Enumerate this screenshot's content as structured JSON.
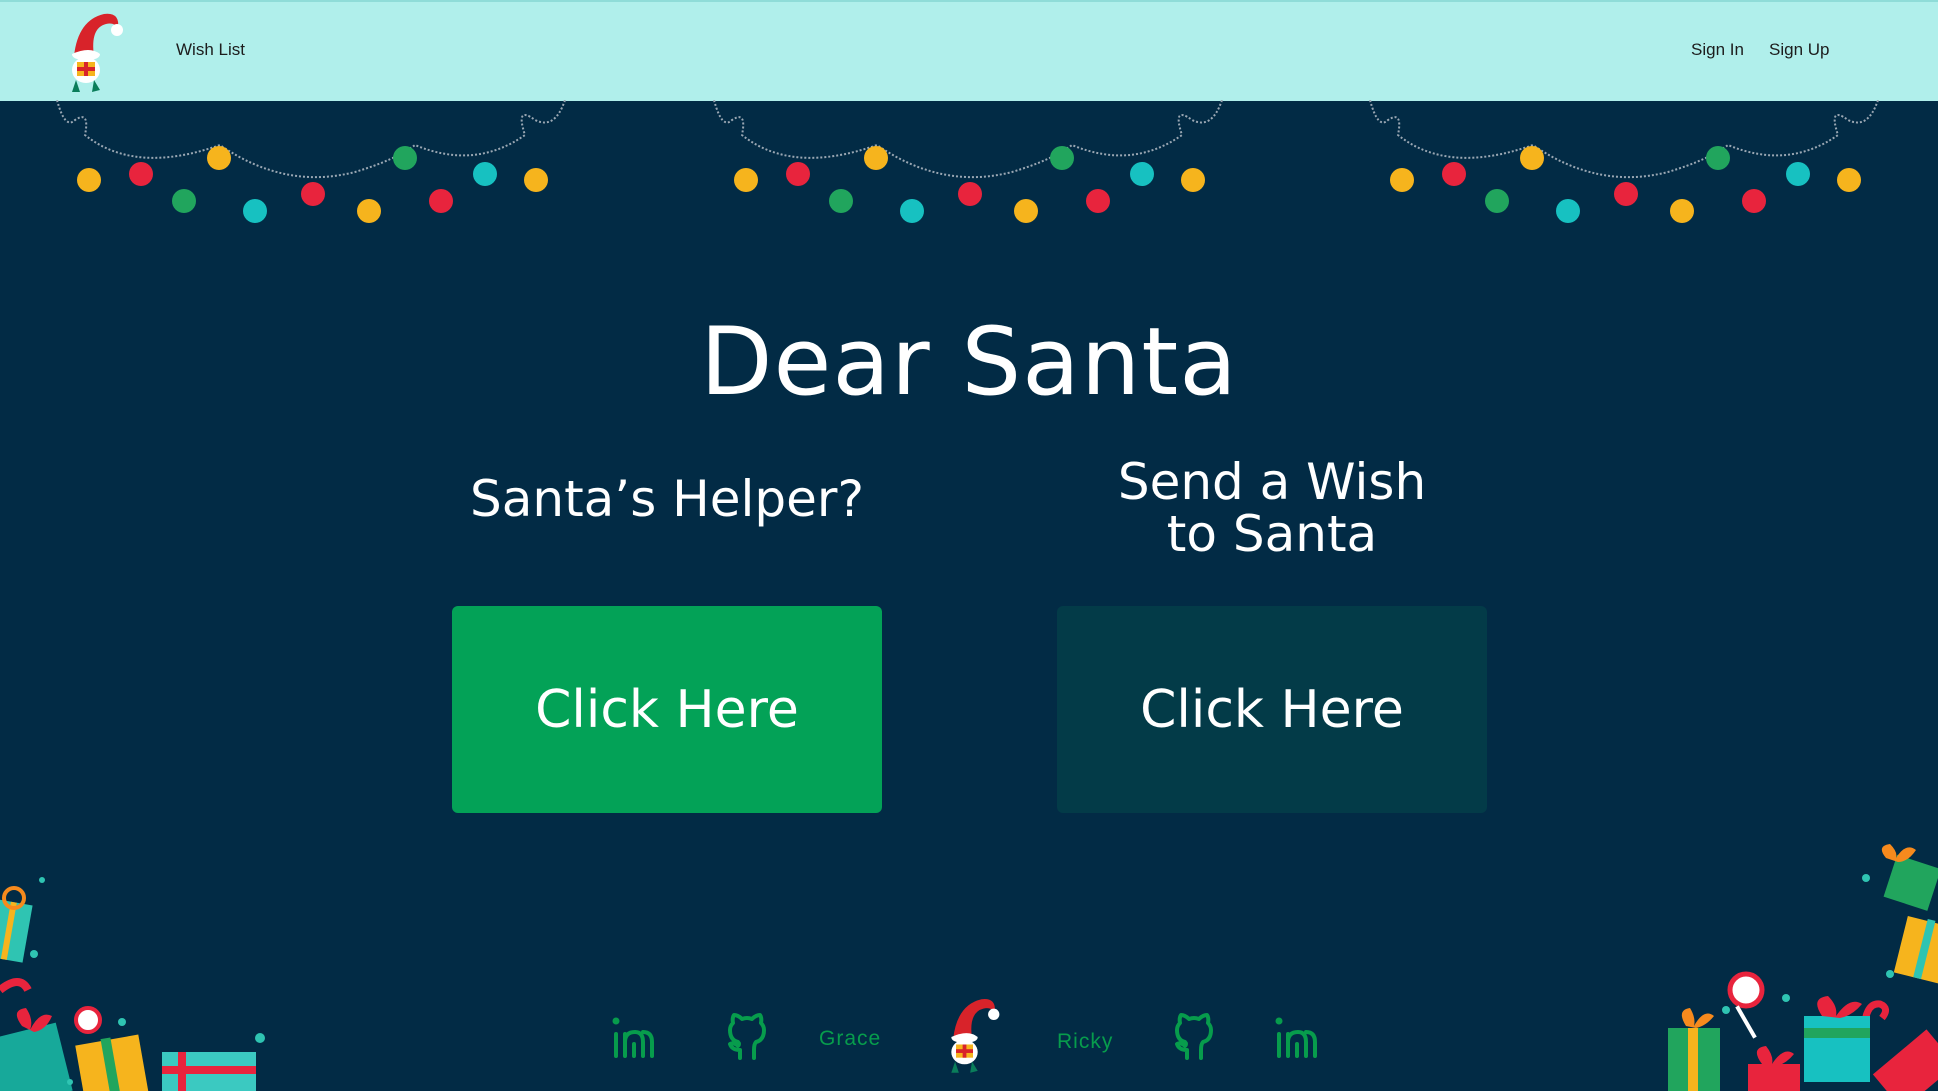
{
  "nav": {
    "logo_icon": "gnome-logo-icon",
    "wish_list_label": "Wish List",
    "sign_in_label": "Sign In",
    "sign_up_label": "Sign Up"
  },
  "hero": {
    "title": "Dear Santa"
  },
  "columns": {
    "helper": {
      "heading": "Santa’s Helper?",
      "button_label": "Click Here",
      "button_color": "#03a257"
    },
    "wish": {
      "heading": "Send a Wish\nto Santa",
      "button_label": "Click Here",
      "button_color": "#033b48"
    }
  },
  "footer": {
    "left_linkedin_icon": "linkedin-icon",
    "left_github_icon": "github-icon",
    "left_name": "Grace",
    "mascot_icon": "gnome-logo-icon",
    "right_name": "Ricky",
    "right_github_icon": "github-icon",
    "right_linkedin_icon": "linkedin-icon"
  },
  "colors": {
    "navbar_bg": "#b0efeb",
    "page_bg": "#022b45",
    "footer_accent": "#079c4c"
  }
}
